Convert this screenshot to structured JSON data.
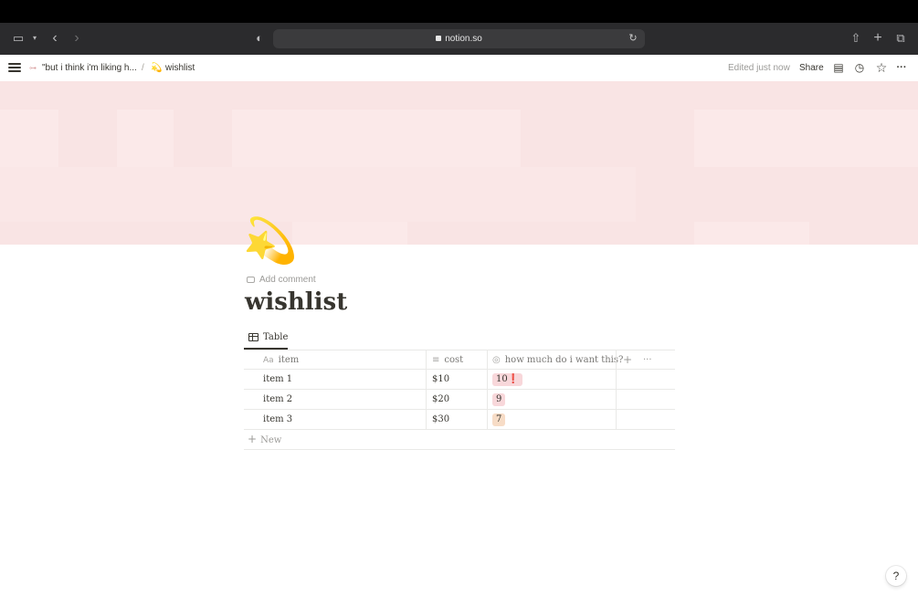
{
  "browser": {
    "url": "notion.so"
  },
  "notion_top": {
    "breadcrumb_parent": "\"but i think i'm liking h...",
    "breadcrumb_separator": "/",
    "breadcrumb_current_icon": "💫",
    "breadcrumb_current": "wishlist",
    "edited_status": "Edited just now",
    "share_label": "Share"
  },
  "page": {
    "icon": "💫",
    "add_comment": "Add comment",
    "title": "wishlist"
  },
  "view": {
    "tab_label": "Table"
  },
  "table": {
    "columns": [
      {
        "label": "item",
        "icon": "Aa"
      },
      {
        "label": "cost",
        "icon": "≡"
      },
      {
        "label": "how much do i want this?",
        "icon": "◎"
      }
    ],
    "rows": [
      {
        "item": "item 1",
        "cost": "$10",
        "want": "10❗",
        "tag_color": "#f8d7da"
      },
      {
        "item": "item 2",
        "cost": "$20",
        "want": "9",
        "tag_color": "#f8d7da"
      },
      {
        "item": "item 3",
        "cost": "$30",
        "want": "7",
        "tag_color": "#f7dcc6"
      }
    ],
    "add_column": "+",
    "more": "···",
    "new_row": "New"
  },
  "help_label": "?",
  "colors": {
    "cover": "#f9e4e4",
    "text": "#37352f",
    "muted": "#9b9a97"
  }
}
